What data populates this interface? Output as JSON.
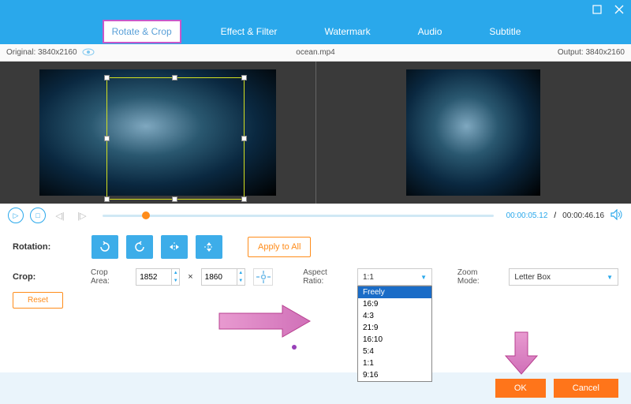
{
  "titlebar": {
    "min": "—",
    "close": "✕"
  },
  "tabs": {
    "rotate_crop": "Rotate & Crop",
    "effect_filter": "Effect & Filter",
    "watermark": "Watermark",
    "audio": "Audio",
    "subtitle": "Subtitle"
  },
  "infobar": {
    "original_label": "Original:",
    "original_res": "3840x2160",
    "filename": "ocean.mp4",
    "output_label": "Output:",
    "output_res": "3840x2160"
  },
  "player": {
    "current": "00:00:05.12",
    "sep": "/",
    "duration": "00:00:46.16"
  },
  "rotation": {
    "label": "Rotation:",
    "apply_all": "Apply to All"
  },
  "crop": {
    "label": "Crop:",
    "area_label": "Crop Area:",
    "width": "1852",
    "times": "×",
    "height": "1860",
    "aspect_label": "Aspect Ratio:",
    "aspect_value": "1:1",
    "zoom_label": "Zoom Mode:",
    "zoom_value": "Letter Box",
    "reset": "Reset"
  },
  "aspect_options": [
    "Freely",
    "16:9",
    "4:3",
    "21:9",
    "16:10",
    "5:4",
    "1:1",
    "9:16"
  ],
  "footer": {
    "ok": "OK",
    "cancel": "Cancel"
  }
}
